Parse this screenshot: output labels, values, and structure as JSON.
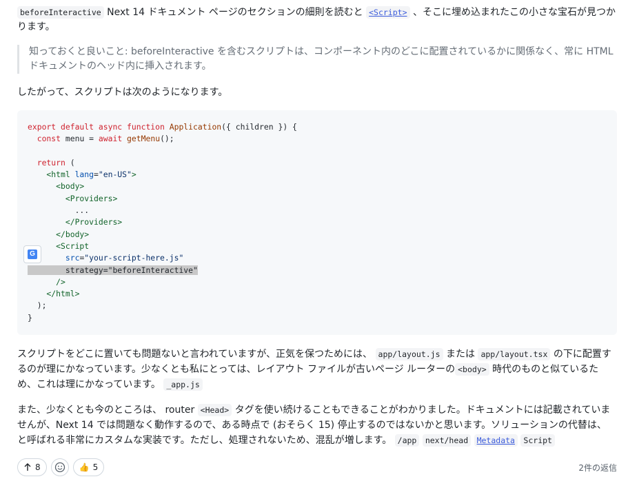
{
  "p1": {
    "code1": "beforeInteractive",
    "text1": " Next 14 ドキュメント ページのセクションの細則を読むと ",
    "code2": "<Script>",
    "text2": " 、そこに埋め込まれたこの小さな宝石が見つかります。"
  },
  "quote": "知っておくと良いこと: beforeInteractive を含むスクリプトは、コンポーネント内のどこに配置されているかに関係なく、常に HTML ドキュメントのヘッド内に挿入されます。",
  "p2": "したがって、スクリプトは次のようになります。",
  "code": {
    "l1a": "export default async function ",
    "l1b": "Application",
    "l1c": "({ children }) {",
    "l2a": "  const ",
    "l2b": "menu = ",
    "l2c": "await ",
    "l2d": "getMenu",
    "l2e": "();",
    "l4a": "  return ",
    "l4b": "(",
    "l5a": "    <html ",
    "l5b": "lang",
    "l5c": "=",
    "l5d": "\"en-US\"",
    "l5e": ">",
    "l6": "      <body>",
    "l7": "        <Providers>",
    "l8": "          ...",
    "l9": "        </Providers>",
    "l10": "      </body>",
    "l11": "      <Script",
    "l12a": "        src",
    "l12b": "=",
    "l12c": "\"your-script-here.js\"",
    "l13": "        strategy=\"beforeInteractive\"",
    "l14": "      />",
    "l15": "    </html>",
    "l16": "  );",
    "l17": "}"
  },
  "p3": {
    "t1": "スクリプトをどこに置いても問題ないと言われていますが、正気を保つためには、 ",
    "c1": "app/layout.js",
    "t2": " または ",
    "c2": "app/layout.tsx",
    "t3": " の下に配置するのが理にかなっています。少なくとも私にとっては、レイアウト ファイルが古いページ ルーターの",
    "c3": "<body>",
    "t4": " 時代のものと似ているため、これは理にかなっています。 ",
    "c4": "_app.js"
  },
  "p4": {
    "t1": "また、少なくとも今のところは、 router ",
    "c1": "<Head>",
    "t2": " タグを使い続けることもできることがわかりました。ドキュメントには記載されていませんが、Next 14 では問題なく動作するので、ある時点で (おそらく 15) 停止するのではないかと思います。ソリューションの代替は、 と呼ばれる非常にカスタムな実装です。ただし、処理されないため、混乱が増します。 ",
    "c2": "/app",
    "c3": "next/head",
    "c4": "Metadata",
    "c5": "Script"
  },
  "actions": {
    "upvote_count": "8",
    "thumbs_count": "5",
    "replies": "2件の返信"
  }
}
